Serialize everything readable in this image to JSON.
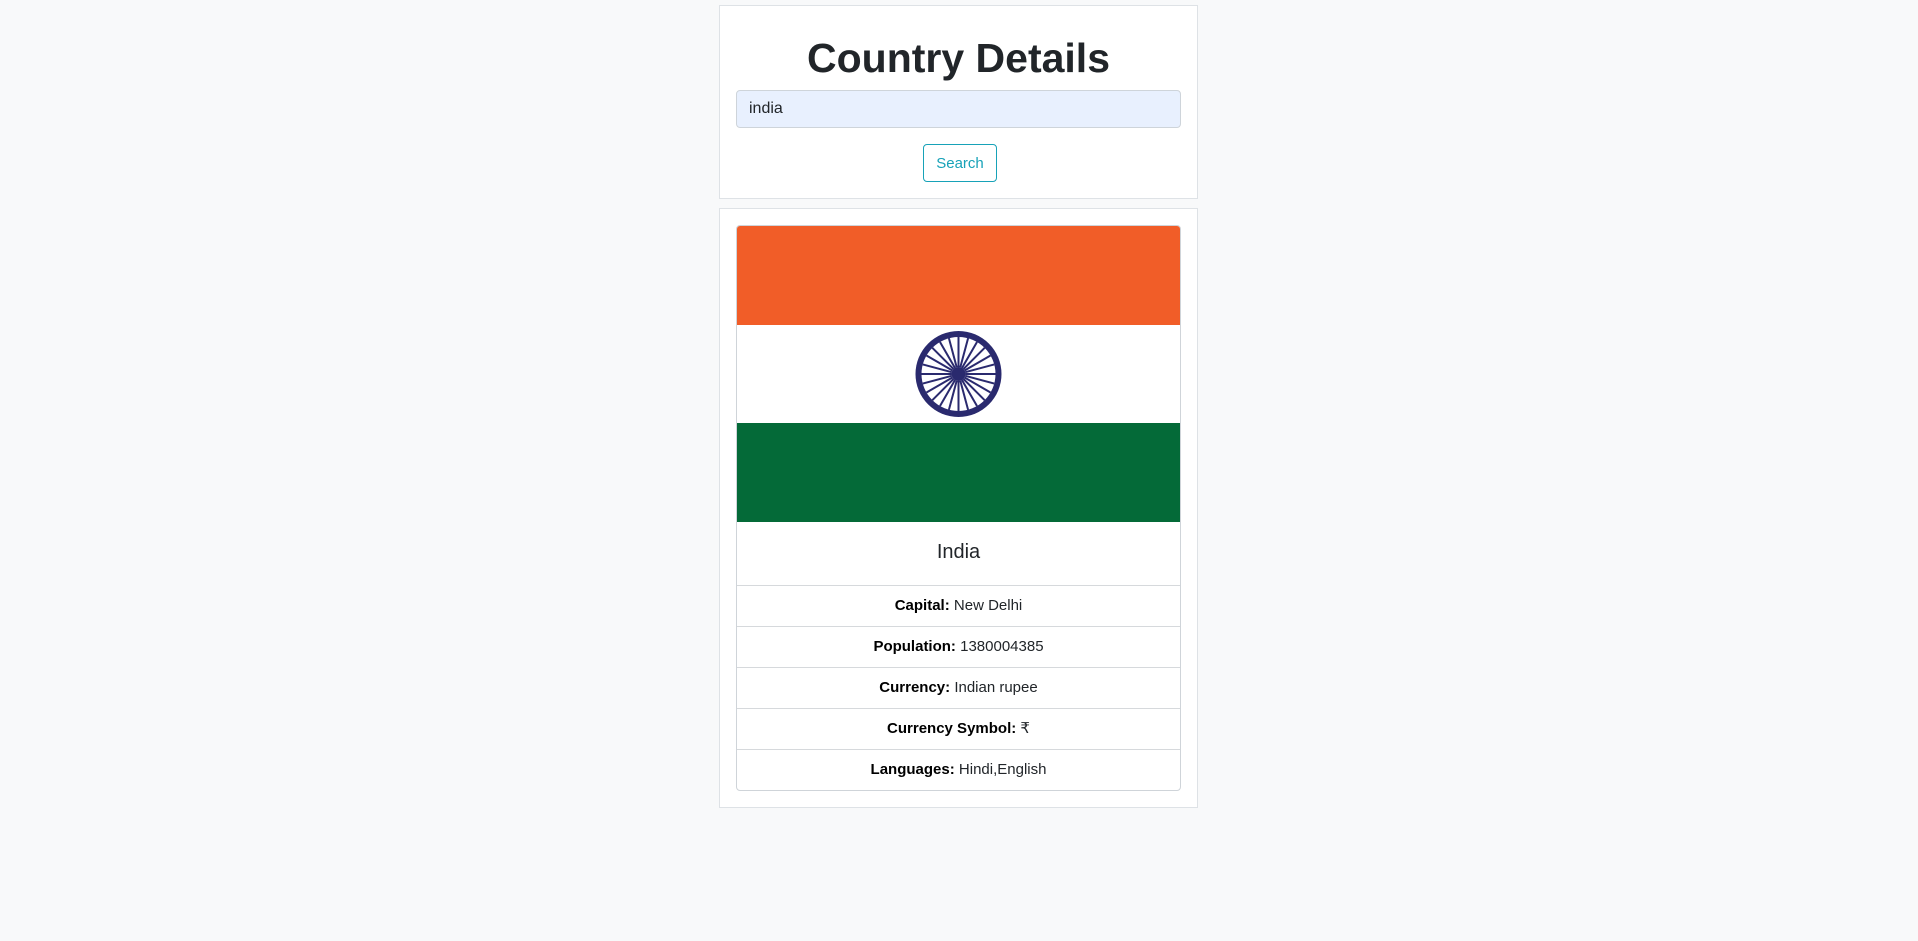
{
  "search": {
    "title": "Country Details",
    "query_value": "india",
    "button_label": "Search"
  },
  "country": {
    "flag_icon": "india-flag",
    "flag_colors": {
      "saffron": "#f15d28",
      "white": "#ffffff",
      "green": "#046a38",
      "chakra": "#2a2a6e"
    },
    "name": "India",
    "details": [
      {
        "label": "Capital:",
        "value": "New Delhi"
      },
      {
        "label": "Population:",
        "value": "1380004385"
      },
      {
        "label": "Currency:",
        "value": "Indian rupee"
      },
      {
        "label": "Currency Symbol:",
        "value": "₹"
      },
      {
        "label": "Languages:",
        "value": "Hindi,English"
      }
    ]
  },
  "theme": {
    "accent": "#17a2b8",
    "input_background": "#e8f0fe"
  }
}
